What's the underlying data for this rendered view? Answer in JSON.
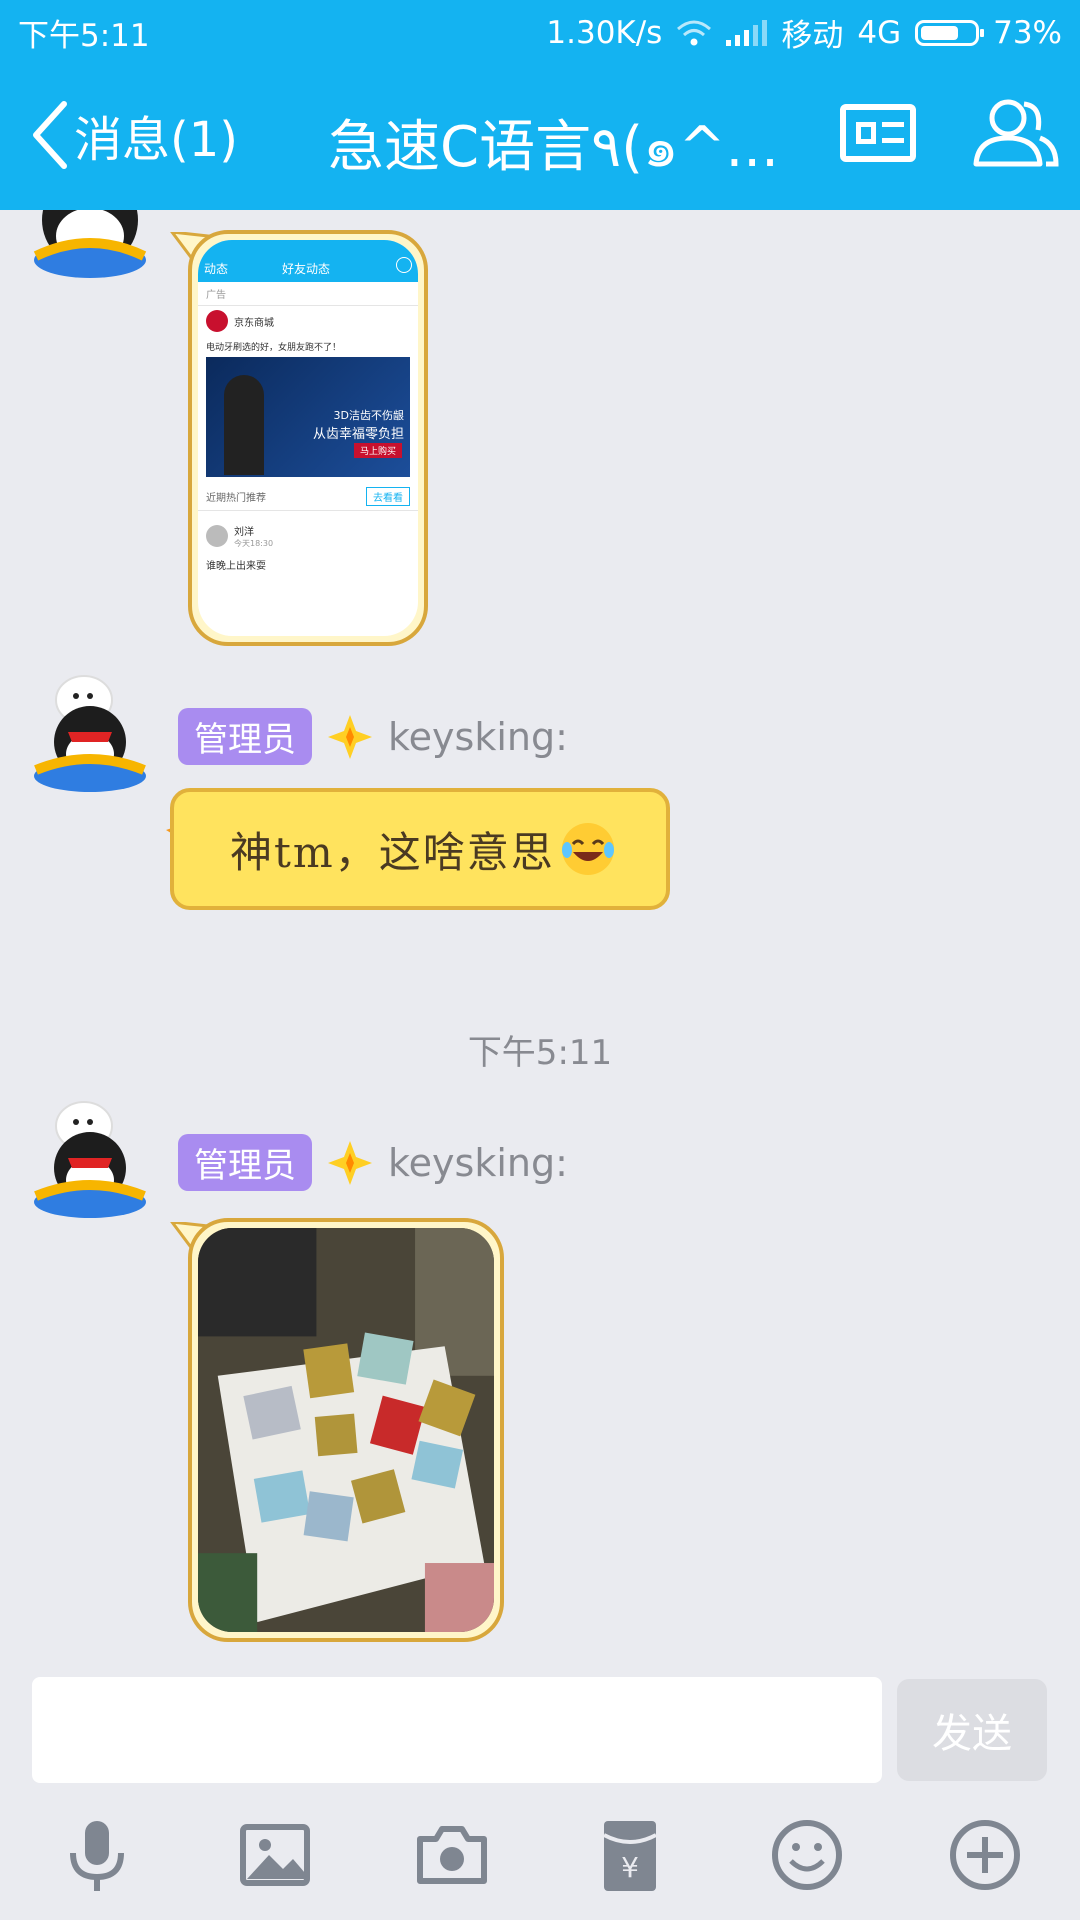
{
  "status_bar": {
    "time": "下午5:11",
    "net_speed": "1.30K/s",
    "carrier": "移动",
    "network": "4G",
    "battery": "73%",
    "battery_level": 0.73
  },
  "header": {
    "back_label": "消息(1)",
    "title": "急速C语言٩(๑^..."
  },
  "messages": [
    {
      "id": "m1",
      "type": "image",
      "image_preview": {
        "nav_back": "动态",
        "nav_title": "好友动态",
        "ad_label": "广告",
        "ad_brand": "京东商城",
        "ad_text": "电动牙刷选的好，女朋友跑不了！",
        "ad_slogan_1": "3D洁齿不伤龈",
        "ad_slogan_2": "从齿幸福零负担",
        "ad_cta": "马上购买",
        "ad_footer": "近期热门推荐",
        "ad_button": "去看看",
        "post_user": "刘洋",
        "post_time": "今天18:30",
        "post_text": "谁晚上出来耍"
      }
    },
    {
      "id": "m2",
      "type": "text",
      "role": "管理员",
      "sender": "keysking:",
      "text": "神tm，这啥意思"
    },
    {
      "id": "m3",
      "type": "image",
      "role": "管理员",
      "sender": "keysking:"
    }
  ],
  "time_divider": "下午5:11",
  "input": {
    "value": "",
    "send_label": "发送"
  },
  "toolbar_icons": [
    "microphone-icon",
    "image-icon",
    "camera-icon",
    "red-packet-icon",
    "emoji-icon",
    "plus-icon"
  ],
  "colors": {
    "header_bg": "#14b3f1",
    "role_badge": "#a98cf0",
    "bubble_yellow": "#ffe35e",
    "chat_bg": "#eaebf0"
  }
}
